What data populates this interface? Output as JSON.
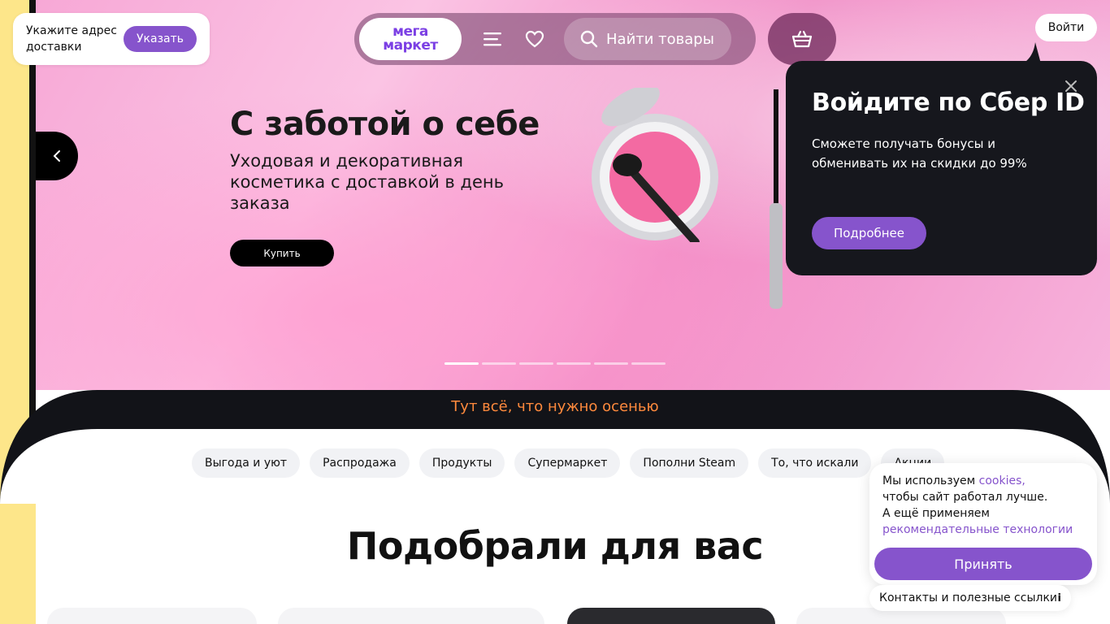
{
  "address": {
    "prompt": "Укажите адрес доставки",
    "button": "Указать"
  },
  "header": {
    "logo_line1": "мега",
    "logo_line2": "маркет",
    "search_label": "Найти товары",
    "login": "Войти"
  },
  "hero": {
    "title": "С заботой о себе",
    "subtitle": "Уходовая и декоративная косметика с доставкой в день заказа",
    "buy_button": "Купить"
  },
  "popup": {
    "title": "Войдите по Сбер ID",
    "text": "Сможете получать бонусы и обменивать их на скидки до 99%",
    "button": "Подробнее"
  },
  "promo": {
    "text": "Тут всё, что нужно осенью"
  },
  "chips": [
    "Выгода и уют",
    "Распродажа",
    "Продукты",
    "Супермаркет",
    "Пополни Steam",
    "То, что искали",
    "Акции"
  ],
  "section": {
    "title": "Подобрали для вас"
  },
  "cookie": {
    "line1": "Мы используем ",
    "link1": "cookies,",
    "line2": "чтобы сайт работал лучше.",
    "line3": "А ещё применяем",
    "link2": "рекомендательные технологии",
    "accept": "Принять"
  },
  "contacts": {
    "label": "Контакты и полезные ссылки",
    "info_icon": "i"
  },
  "colors": {
    "accent": "#8654cc",
    "promo": "#ff8a3d",
    "dark": "#16171d"
  }
}
